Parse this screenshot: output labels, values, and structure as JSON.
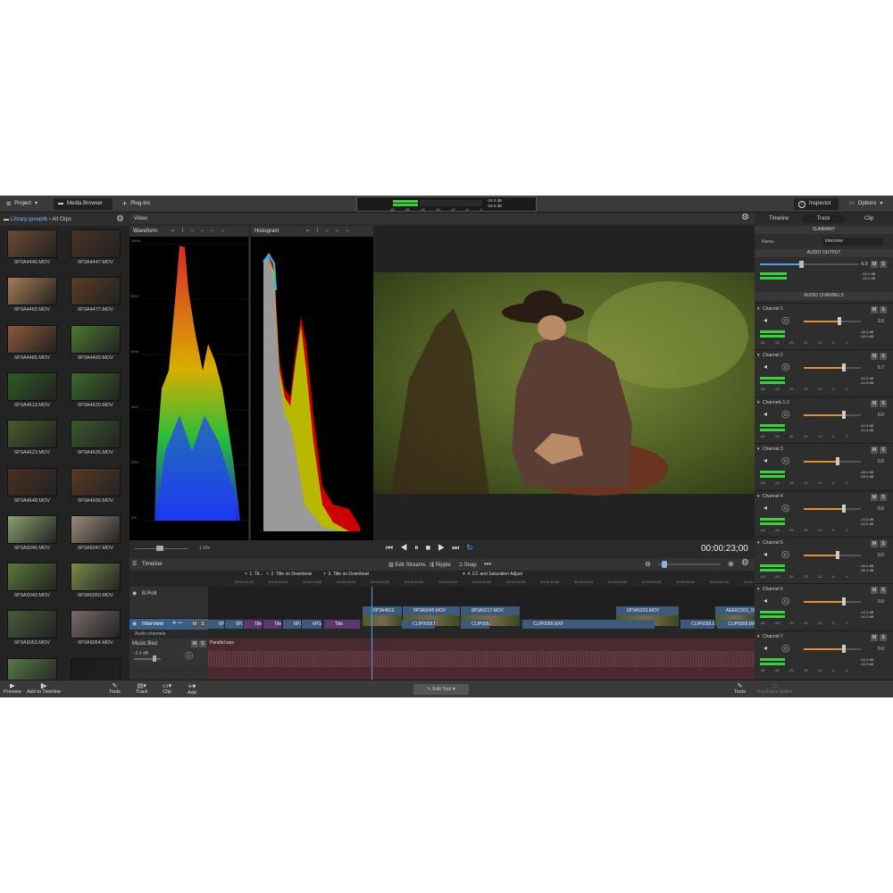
{
  "topbar": {
    "project": "Project",
    "media_browser": "Media Browser",
    "plugins": "Plug-Ins",
    "meter_top": "-19.3 dB",
    "meter_bottom": "-19.5 dB",
    "meter_scale": [
      "-60",
      "-45",
      "-30",
      "-20",
      "-12",
      "-6",
      "0"
    ],
    "inspector": "Inspector",
    "options": "Options"
  },
  "browser": {
    "library": "Library.cpveplib",
    "all_clips": "All Clips",
    "clips": [
      {
        "name": "6P3A4446.MOV",
        "color": "#6b4a34"
      },
      {
        "name": "6P3A4447.MOV",
        "color": "#4a3426"
      },
      {
        "name": "6P3A4463.MOV",
        "color": "#a67c56"
      },
      {
        "name": "6P3A4477.MOV",
        "color": "#5a3c24"
      },
      {
        "name": "6P3A4485.MOV",
        "color": "#8a5a3a"
      },
      {
        "name": "6P3A4493.MOV",
        "color": "#4c7a30"
      },
      {
        "name": "6P3A4613.MOV",
        "color": "#2f5a24"
      },
      {
        "name": "6P3A4620.MOV",
        "color": "#3c6a2c"
      },
      {
        "name": "6P3A4623.MOV",
        "color": "#4a5a2a"
      },
      {
        "name": "6P3A4626.MOV",
        "color": "#3a5a2c"
      },
      {
        "name": "6P3A4648.MOV",
        "color": "#4a3020"
      },
      {
        "name": "6P3A4656.MOV",
        "color": "#5a3a22"
      },
      {
        "name": "6P3A5045.MOV",
        "color": "#8aa070"
      },
      {
        "name": "6P3A5047.MOV",
        "color": "#9a8a7a"
      },
      {
        "name": "6P3A5049.MOV",
        "color": "#5a7a3a"
      },
      {
        "name": "6P3A5050.MOV",
        "color": "#7a8a4a"
      },
      {
        "name": "6P3A5053.MOV",
        "color": "#4a5a3a"
      },
      {
        "name": "6P3A5054.MOV",
        "color": "#7a6a6a"
      },
      {
        "name": "",
        "color": "#5a7a4a"
      },
      {
        "name": "",
        "color": "#1a1a1a"
      }
    ]
  },
  "video": {
    "title": "Video",
    "waveform": "Waveform",
    "histogram": "Histogram",
    "wf_scale": [
      "100%",
      "80%",
      "60%",
      "40%",
      "20%",
      "0%"
    ],
    "zoom": "1.00x",
    "timecode": "00:00:23;00"
  },
  "timeline": {
    "title": "Timeline",
    "edit_streams": "Edit Streams",
    "ripple": "Ripple",
    "snap": "Snap",
    "markers": [
      "1. Tit...",
      "2. Title on Downbeat",
      "3. Title on Downbeat",
      "4. CC and Saturation Adjust"
    ],
    "ruler": [
      "00:00:04;00",
      "00:00:08;00",
      "00:00:12;00",
      "00:00:16;00",
      "00:00:20;00",
      "00:00:24;00",
      "00:00:28;00",
      "00:00:32;00",
      "00:00:36;00",
      "00:00:40;00",
      "00:00:44;00",
      "00:00:48;00",
      "00:00:52;00",
      "00:00:56;00",
      "00:01:00;00",
      "00:01:04;00"
    ],
    "tracks": {
      "broll": "B-Roll",
      "interview": "Interview",
      "audio_channels": "Audio channels",
      "music": "Music Bed",
      "music_db": "-3.4 dB",
      "music_file": "Parallel.wav"
    },
    "broll_clips": [
      "6P3A4613",
      "6P3A5045.MOV",
      "6P3A5217.MOV",
      "6P3A5233.MOV",
      "AEE6C003_150721"
    ],
    "interview_clips": [
      "6P3A",
      "6P3A",
      "Title",
      "Title",
      "6P3A",
      "6P3A",
      "Title",
      "CLIP0058.MXF",
      "CLIP0058.M",
      "CLIP0058.MXF",
      "CLIP0058.MXF",
      "CLIP0058.MXF"
    ]
  },
  "inspector": {
    "tabs": [
      "Timeline",
      "Track",
      "Clip"
    ],
    "summary": "SUMMARY",
    "name_label": "Name:",
    "name_value": "Interview",
    "audio_output": "AUDIO OUTPUT",
    "out_value": "-6.9",
    "out_db1": "-19.1 dB",
    "out_db2": "-19.1 dB",
    "audio_channels": "AUDIO CHANNELS",
    "channels": [
      {
        "name": "Channel 1",
        "value": "2.0",
        "db1": "-18.4 dB",
        "db2": "-18.4 dB",
        "level": 0.62
      },
      {
        "name": "Channel 2",
        "value": "5.7",
        "db1": "-14.3 dB",
        "db2": "-14.3 dB",
        "level": 0.7
      },
      {
        "name": "Channels 1-2",
        "value": "0.0",
        "db1": "-14.3 dB",
        "db2": "-14.3 dB",
        "level": 0.7
      },
      {
        "name": "Channel 3",
        "value": "0.0",
        "db1": "-18.4 dB",
        "db2": "-18.4 dB",
        "level": 0.6
      },
      {
        "name": "Channel 4",
        "value": "0.0",
        "db1": "-14.3 dB",
        "db2": "-14.3 dB",
        "level": 0.7
      },
      {
        "name": "Channel 5",
        "value": "0.0",
        "db1": "-18.4 dB",
        "db2": "-18.4 dB",
        "level": 0.6
      },
      {
        "name": "Channel 6",
        "value": "0.0",
        "db1": "-14.3 dB",
        "db2": "-14.3 dB",
        "level": 0.7
      },
      {
        "name": "Channel 7",
        "value": "0.0",
        "db1": "-14.3 dB",
        "db2": "-14.3 dB",
        "level": 0.7
      }
    ],
    "meter_scale": [
      "-60",
      "-45",
      "-30",
      "-20",
      "-12",
      "-6",
      "0"
    ]
  },
  "bottombar": {
    "preview": "Preview",
    "add_to_timeline": "Add to Timeline",
    "tools_left": "Tools",
    "track": "Track",
    "clip": "Clip",
    "add": "Add",
    "edit_tool": "Edit Tool",
    "tools_right": "Tools",
    "keyframe": "Keyframe Editor"
  }
}
